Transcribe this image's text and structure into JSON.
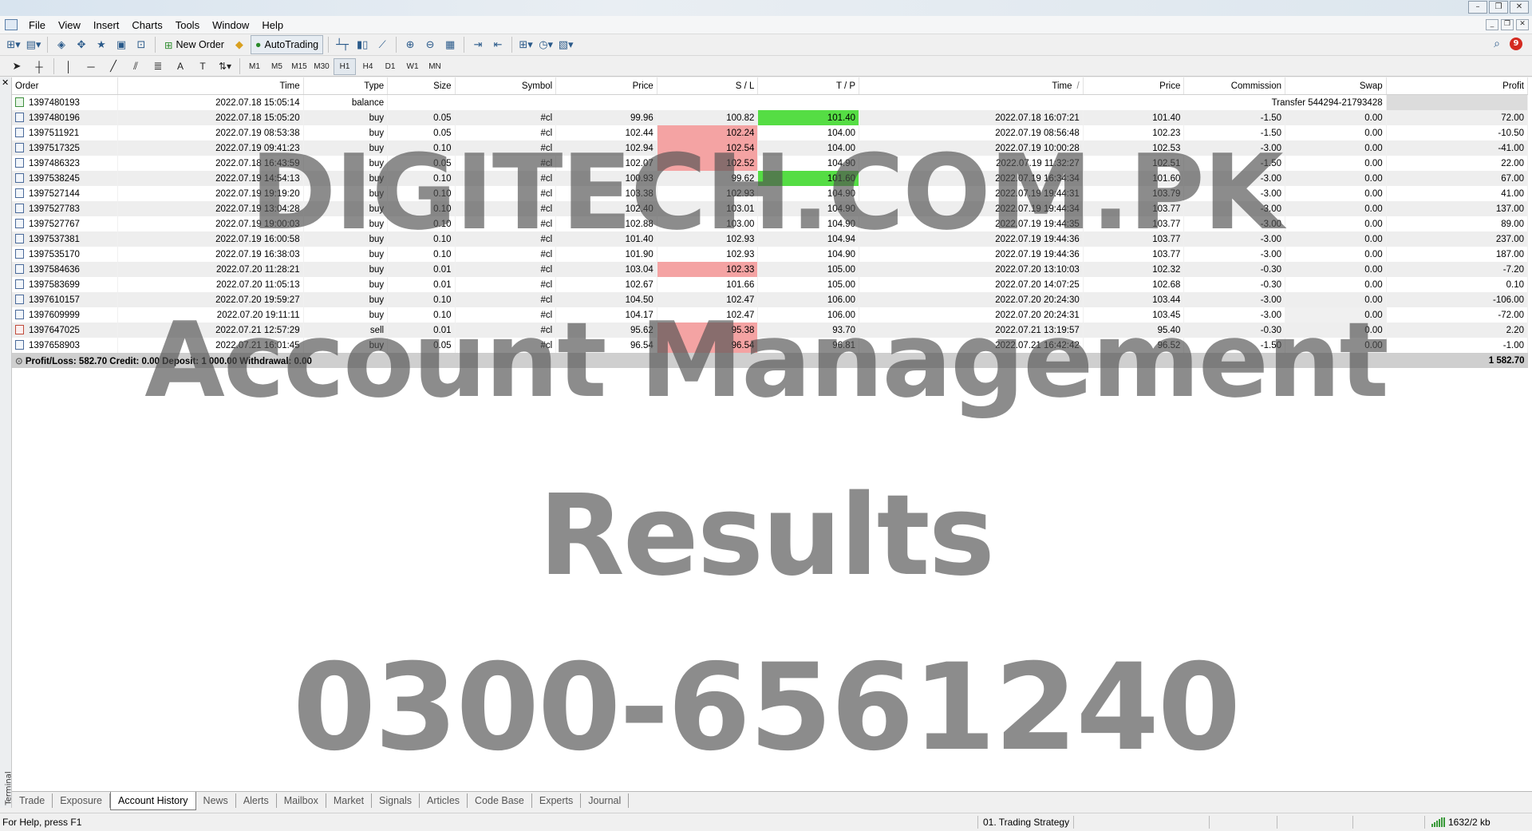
{
  "menu": [
    "File",
    "View",
    "Insert",
    "Charts",
    "Tools",
    "Window",
    "Help"
  ],
  "toolbar": {
    "new_order": "New Order",
    "auto_trading": "AutoTrading",
    "notifications_count": "9"
  },
  "timeframes": [
    "M1",
    "M5",
    "M15",
    "M30",
    "H1",
    "H4",
    "D1",
    "W1",
    "MN"
  ],
  "active_timeframe": "H1",
  "columns": [
    "Order",
    "Time",
    "Type",
    "Size",
    "Symbol",
    "Price",
    "S / L",
    "T / P",
    "Time",
    "Price",
    "Commission",
    "Swap",
    "Profit"
  ],
  "sort_indicator": "/",
  "balance_row": {
    "order": "1397480193",
    "time": "2022.07.18 15:05:14",
    "type": "balance",
    "comment": "Transfer 544294-21793428"
  },
  "rows": [
    {
      "order": "1397480196",
      "time": "2022.07.18 15:05:20",
      "type": "buy",
      "size": "0.05",
      "symbol": "#cl",
      "price": "99.96",
      "sl": "100.82",
      "tp": "101.40",
      "close_time": "2022.07.18 16:07:21",
      "close_price": "101.40",
      "commission": "-1.50",
      "swap": "0.00",
      "profit": "72.00",
      "tp_hit": true
    },
    {
      "order": "1397511921",
      "time": "2022.07.19 08:53:38",
      "type": "buy",
      "size": "0.05",
      "symbol": "#cl",
      "price": "102.44",
      "sl": "102.24",
      "tp": "104.00",
      "close_time": "2022.07.19 08:56:48",
      "close_price": "102.23",
      "commission": "-1.50",
      "swap": "0.00",
      "profit": "-10.50",
      "sl_hit": true
    },
    {
      "order": "1397517325",
      "time": "2022.07.19 09:41:23",
      "type": "buy",
      "size": "0.10",
      "symbol": "#cl",
      "price": "102.94",
      "sl": "102.54",
      "tp": "104.00",
      "close_time": "2022.07.19 10:00:28",
      "close_price": "102.53",
      "commission": "-3.00",
      "swap": "0.00",
      "profit": "-41.00",
      "sl_hit": true
    },
    {
      "order": "1397486323",
      "time": "2022.07.18 16:43:59",
      "type": "buy",
      "size": "0.05",
      "symbol": "#cl",
      "price": "102.07",
      "sl": "102.52",
      "tp": "104.90",
      "close_time": "2022.07.19 11:32:27",
      "close_price": "102.51",
      "commission": "-1.50",
      "swap": "0.00",
      "profit": "22.00",
      "sl_hit": true
    },
    {
      "order": "1397538245",
      "time": "2022.07.19 14:54:13",
      "type": "buy",
      "size": "0.10",
      "symbol": "#cl",
      "price": "100.93",
      "sl": "99.62",
      "tp": "101.60",
      "close_time": "2022.07.19 16:34:34",
      "close_price": "101.60",
      "commission": "-3.00",
      "swap": "0.00",
      "profit": "67.00",
      "tp_hit": true
    },
    {
      "order": "1397527144",
      "time": "2022.07.19 19:19:20",
      "type": "buy",
      "size": "0.10",
      "symbol": "#cl",
      "price": "103.38",
      "sl": "102.93",
      "tp": "104.90",
      "close_time": "2022.07.19 19:44:31",
      "close_price": "103.79",
      "commission": "-3.00",
      "swap": "0.00",
      "profit": "41.00"
    },
    {
      "order": "1397527783",
      "time": "2022.07.19 13:04:28",
      "type": "buy",
      "size": "0.10",
      "symbol": "#cl",
      "price": "102.40",
      "sl": "103.01",
      "tp": "104.90",
      "close_time": "2022.07.19 19:44:34",
      "close_price": "103.77",
      "commission": "-3.00",
      "swap": "0.00",
      "profit": "137.00"
    },
    {
      "order": "1397527767",
      "time": "2022.07.19 19:00:03",
      "type": "buy",
      "size": "0.10",
      "symbol": "#cl",
      "price": "102.88",
      "sl": "103.00",
      "tp": "104.90",
      "close_time": "2022.07.19 19:44:35",
      "close_price": "103.77",
      "commission": "-3.00",
      "swap": "0.00",
      "profit": "89.00"
    },
    {
      "order": "1397537381",
      "time": "2022.07.19 16:00:58",
      "type": "buy",
      "size": "0.10",
      "symbol": "#cl",
      "price": "101.40",
      "sl": "102.93",
      "tp": "104.94",
      "close_time": "2022.07.19 19:44:36",
      "close_price": "103.77",
      "commission": "-3.00",
      "swap": "0.00",
      "profit": "237.00"
    },
    {
      "order": "1397535170",
      "time": "2022.07.19 16:38:03",
      "type": "buy",
      "size": "0.10",
      "symbol": "#cl",
      "price": "101.90",
      "sl": "102.93",
      "tp": "104.90",
      "close_time": "2022.07.19 19:44:36",
      "close_price": "103.77",
      "commission": "-3.00",
      "swap": "0.00",
      "profit": "187.00"
    },
    {
      "order": "1397584636",
      "time": "2022.07.20 11:28:21",
      "type": "buy",
      "size": "0.01",
      "symbol": "#cl",
      "price": "103.04",
      "sl": "102.33",
      "tp": "105.00",
      "close_time": "2022.07.20 13:10:03",
      "close_price": "102.32",
      "commission": "-0.30",
      "swap": "0.00",
      "profit": "-7.20",
      "sl_hit": true
    },
    {
      "order": "1397583699",
      "time": "2022.07.20 11:05:13",
      "type": "buy",
      "size": "0.01",
      "symbol": "#cl",
      "price": "102.67",
      "sl": "101.66",
      "tp": "105.00",
      "close_time": "2022.07.20 14:07:25",
      "close_price": "102.68",
      "commission": "-0.30",
      "swap": "0.00",
      "profit": "0.10"
    },
    {
      "order": "1397610157",
      "time": "2022.07.20 19:59:27",
      "type": "buy",
      "size": "0.10",
      "symbol": "#cl",
      "price": "104.50",
      "sl": "102.47",
      "tp": "106.00",
      "close_time": "2022.07.20 20:24:30",
      "close_price": "103.44",
      "commission": "-3.00",
      "swap": "0.00",
      "profit": "-106.00"
    },
    {
      "order": "1397609999",
      "time": "2022.07.20 19:11:11",
      "type": "buy",
      "size": "0.10",
      "symbol": "#cl",
      "price": "104.17",
      "sl": "102.47",
      "tp": "106.00",
      "close_time": "2022.07.20 20:24:31",
      "close_price": "103.45",
      "commission": "-3.00",
      "swap": "0.00",
      "profit": "-72.00",
      "swap_hl": true
    },
    {
      "order": "1397647025",
      "time": "2022.07.21 12:57:29",
      "type": "sell",
      "size": "0.01",
      "symbol": "#cl",
      "price": "95.62",
      "sl": "95.38",
      "tp": "93.70",
      "close_time": "2022.07.21 13:19:57",
      "close_price": "95.40",
      "commission": "-0.30",
      "swap": "0.00",
      "profit": "2.20",
      "sl_hit": true
    },
    {
      "order": "1397658903",
      "time": "2022.07.21 16:01:45",
      "type": "buy",
      "size": "0.05",
      "symbol": "#cl",
      "price": "96.54",
      "sl": "96.54",
      "tp": "96.81",
      "close_time": "2022.07.21 16:42:42",
      "close_price": "96.52",
      "commission": "-1.50",
      "swap": "0.00",
      "profit": "-1.00",
      "sl_hit": true
    }
  ],
  "summary": {
    "text": "Profit/Loss: 582.70  Credit: 0.00  Deposit: 1 000.00  Withdrawal: 0.00",
    "total": "1 582.70"
  },
  "tabs": [
    "Trade",
    "Exposure",
    "Account History",
    "News",
    "Alerts",
    "Mailbox",
    "Market",
    "Signals",
    "Articles",
    "Code Base",
    "Experts",
    "Journal"
  ],
  "active_tab": "Account History",
  "sidebar_label": "Terminal",
  "status": {
    "help": "For Help, press F1",
    "profile": "01. Trading Strategy",
    "connection": "1632/2 kb"
  },
  "watermark": [
    "DIGITECH.COM.PK",
    "Account Management",
    "Results",
    "0300-6561240"
  ],
  "colors": {
    "sl_hit": "#f4a3a3",
    "tp_hit": "#55dd44",
    "row_alt": "#eeeeee",
    "total_row": "#cfcfcf"
  }
}
